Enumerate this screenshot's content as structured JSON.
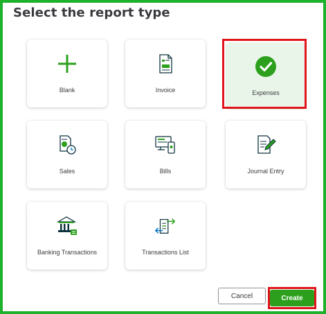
{
  "dialog": {
    "title": "Select the report type"
  },
  "report_types": [
    {
      "label": "Blank",
      "icon": "plus-icon",
      "selected": false
    },
    {
      "label": "Invoice",
      "icon": "invoice-document-icon",
      "selected": false
    },
    {
      "label": "Expenses",
      "icon": "checkmark-circle-icon",
      "selected": true
    },
    {
      "label": "Sales",
      "icon": "sales-report-clock-icon",
      "selected": false
    },
    {
      "label": "Bills",
      "icon": "bills-monitor-phone-icon",
      "selected": false
    },
    {
      "label": "Journal Entry",
      "icon": "journal-pen-icon",
      "selected": false
    },
    {
      "label": "Banking Transactions",
      "icon": "bank-building-icon",
      "selected": false
    },
    {
      "label": "Transactions List",
      "icon": "transactions-arrows-icon",
      "selected": false
    }
  ],
  "buttons": {
    "cancel_label": "Cancel",
    "create_label": "Create"
  },
  "colors": {
    "frame_border": "#1db12c",
    "accent_green": "#2ca01c",
    "icon_green": "#2ca01c",
    "icon_teal": "#0077c5",
    "highlight_red": "#e0141b",
    "selected_bg": "#eaf5ea"
  }
}
